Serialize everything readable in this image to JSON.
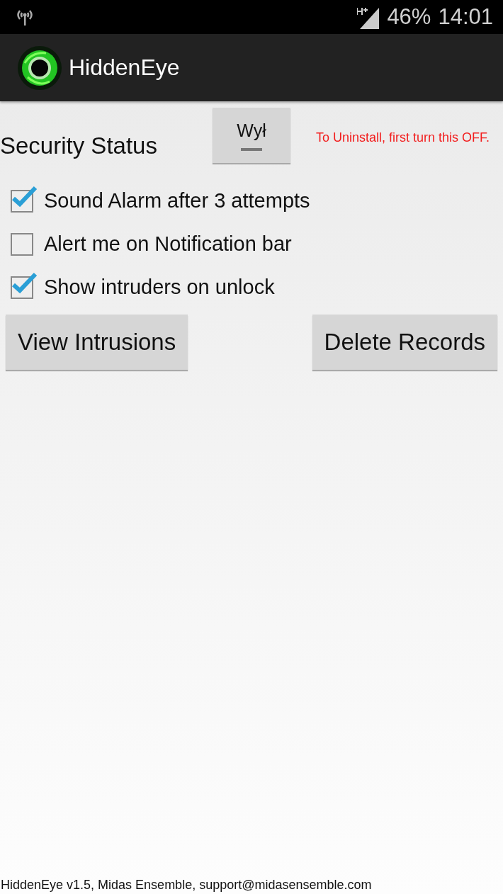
{
  "status_bar": {
    "battery": "46%",
    "time": "14:01"
  },
  "action_bar": {
    "title": "HiddenEye"
  },
  "security": {
    "label": "Security Status",
    "toggle": {
      "label": "Wył",
      "on": false
    },
    "note": "To Uninstall, first turn this OFF."
  },
  "options": [
    {
      "label": "Sound Alarm after 3 attempts",
      "checked": true
    },
    {
      "label": "Alert me on Notification bar",
      "checked": false
    },
    {
      "label": "Show intruders on unlock",
      "checked": true
    }
  ],
  "buttons": [
    "View Intrusions",
    "Delete Records"
  ],
  "footer": "HiddenEye v1.5, Midas Ensemble, support@midasensemble.com"
}
